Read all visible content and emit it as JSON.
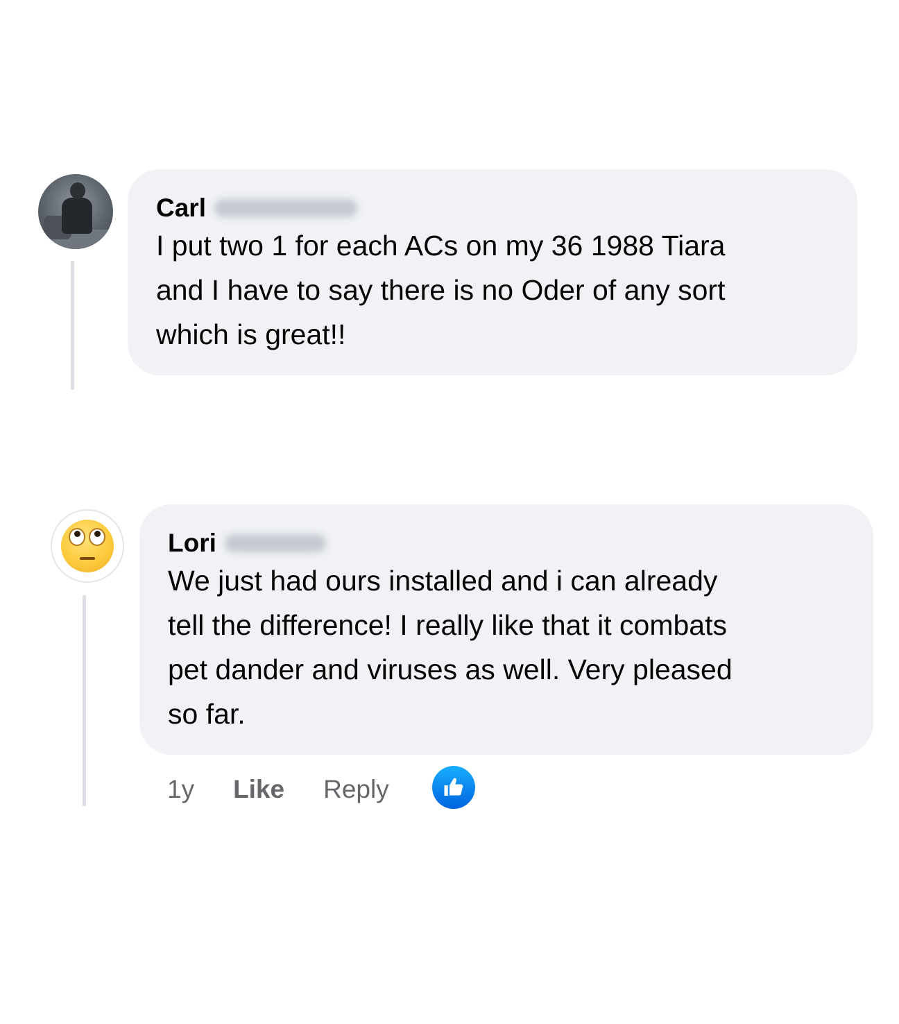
{
  "comments": [
    {
      "author_first": "Carl",
      "author_surname_blurred": true,
      "text": "I put two 1 for each ACs on my 36 1988 Tiara and I have to say there is no Oder of any sort which is great!!",
      "lines": [
        "I put two 1 for each ACs on my 36 1988 Tiara",
        "and I have to say there is no Oder of any sort",
        "which is great!!"
      ],
      "avatar": "profile-photo"
    },
    {
      "author_first": "Lori",
      "author_surname_blurred": true,
      "text": "We just had ours installed and i can already tell the difference! I really like that it combats pet dander and viruses as well. Very pleased so far.",
      "lines": [
        "We just had ours installed and i can already",
        "tell the difference! I really like that it combats",
        "pet dander and viruses as well. Very pleased",
        "so far."
      ],
      "avatar": "face-with-rolling-eyes-emoji",
      "actions": {
        "time": "1y",
        "like_label": "Like",
        "reply_label": "Reply",
        "reaction_icon": "thumbs-up-icon"
      }
    }
  ],
  "colors": {
    "bubble_bg": "#f0f2f5",
    "text": "#050505",
    "secondary_text": "#65676b",
    "like_reaction": "#0866ff",
    "thread_line": "#dcdfe4"
  }
}
